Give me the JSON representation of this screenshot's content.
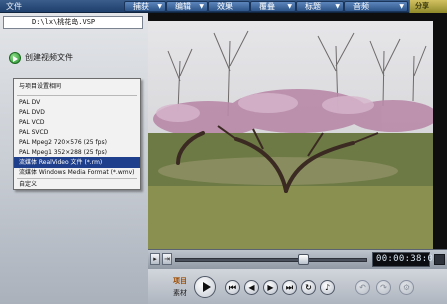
{
  "menubar": {
    "file": "文件",
    "tabs": [
      {
        "label": "捕获"
      },
      {
        "label": "编辑"
      },
      {
        "label": "效果"
      },
      {
        "label": "覆叠"
      },
      {
        "label": "标题"
      },
      {
        "label": "音频"
      }
    ],
    "logo": "分享"
  },
  "left_panel": {
    "file_path": "D:\\lx\\桃花岛.VSP",
    "create_video_label": "创建视频文件",
    "format_menu": {
      "items": [
        {
          "label": "与项目设置相同",
          "selected": false
        },
        {
          "label": "PAL DV",
          "selected": false
        },
        {
          "label": "PAL DVD",
          "selected": false
        },
        {
          "label": "PAL VCD",
          "selected": false
        },
        {
          "label": "PAL SVCD",
          "selected": false
        },
        {
          "label": "PAL Mpeg2 720×576 (25 fps)",
          "selected": false
        },
        {
          "label": "PAL Mpeg1 352×288 (25 fps)",
          "selected": false
        },
        {
          "label": "流媒体 RealVideo 文件 (*.rm)",
          "selected": true
        },
        {
          "label": "流媒体 Windows Media Format (*.wmv)",
          "selected": false
        },
        {
          "label": "自定义",
          "selected": false
        }
      ]
    }
  },
  "timeline": {
    "timecode": "00:00:38:03",
    "scrub_position": 0.67
  },
  "transport": {
    "project_label": "项目",
    "clip_label": "素材",
    "buttons": [
      "play",
      "home",
      "previous-frame",
      "next-frame",
      "end",
      "repeat",
      "volume",
      "undo",
      "redo"
    ]
  },
  "colors": {
    "menubar": "#2b4d7d",
    "selection": "#1e3f8b",
    "logo": "#b9ad45"
  }
}
